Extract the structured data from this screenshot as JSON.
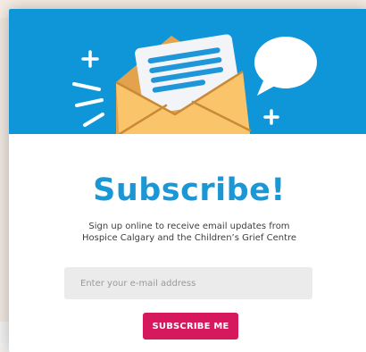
{
  "modal": {
    "title": "Subscribe!",
    "description_line1": "Sign up online to receive email updates from",
    "description_line2": "Hospice Calgary and the Children’s Grief Centre",
    "email_placeholder": "Enter your e-mail address",
    "submit_label": "SUBSCRIBE ME"
  },
  "icons": {
    "hero": "envelope-with-letter-icon",
    "bubble": "speech-bubble-icon",
    "plus": "plus-icon"
  },
  "colors": {
    "hero_bg": "#0f96d8",
    "title": "#1b97d5",
    "button": "#d6195c",
    "envelope": "#f9c46a",
    "input_bg": "#ebebeb"
  }
}
